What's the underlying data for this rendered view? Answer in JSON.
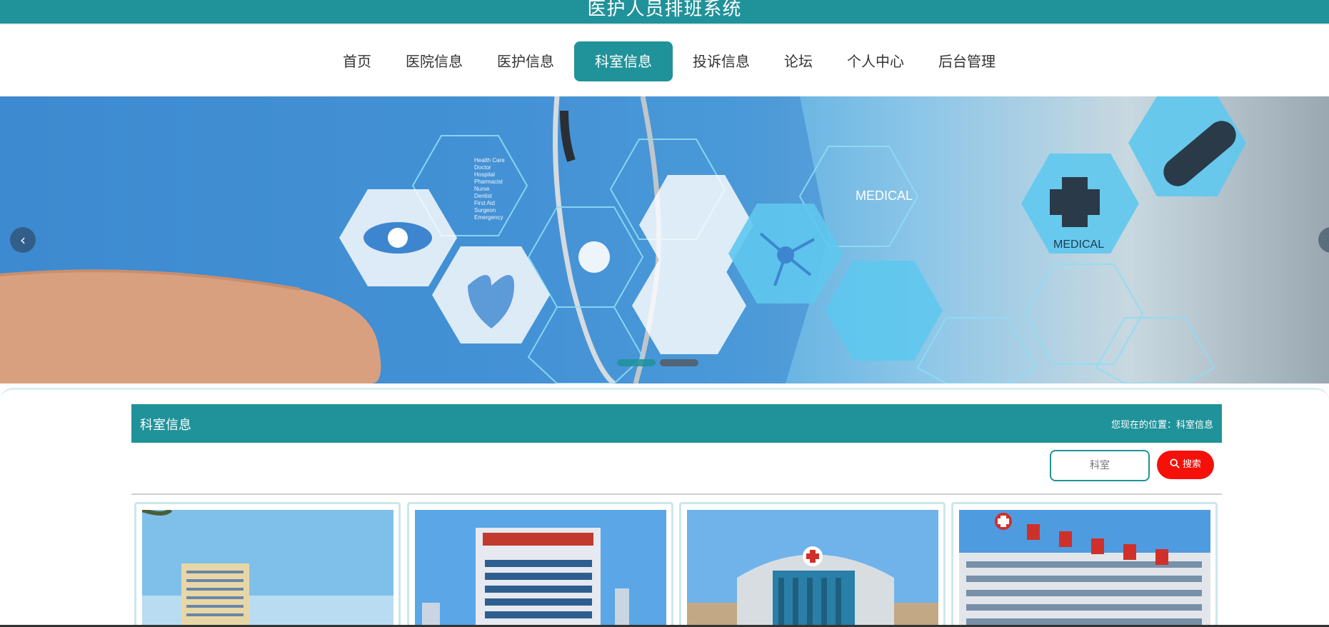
{
  "header": {
    "title": "医护人员排班系统"
  },
  "nav": {
    "items": [
      {
        "label": "首页"
      },
      {
        "label": "医院信息"
      },
      {
        "label": "医护信息"
      },
      {
        "label": "科室信息",
        "active": true
      },
      {
        "label": "投诉信息"
      },
      {
        "label": "论坛"
      },
      {
        "label": "个人中心"
      },
      {
        "label": "后台管理"
      }
    ]
  },
  "banner": {
    "labels": [
      "MEDICAL",
      "MEDICAL"
    ],
    "small_text": [
      "Health Care",
      "Doctor",
      "Hospital",
      "Pharmacist",
      "Nurse",
      "Dentist",
      "First Aid",
      "Surgeon",
      "Emergency"
    ],
    "prev_icon": "chevron-left-icon",
    "next_icon": "chevron-right-icon"
  },
  "section": {
    "title": "科室信息",
    "location_label": "您现在的位置：科室信息"
  },
  "search": {
    "placeholder": "科室",
    "button_label": "搜索",
    "icon": "search-icon"
  },
  "colors": {
    "primary": "#20929a",
    "search_button": "#f5100a"
  },
  "cards": [
    {
      "image": "hospital-building-photo"
    },
    {
      "image": "hospital-building-photo"
    },
    {
      "image": "hospital-building-photo"
    },
    {
      "image": "hospital-building-photo"
    }
  ]
}
